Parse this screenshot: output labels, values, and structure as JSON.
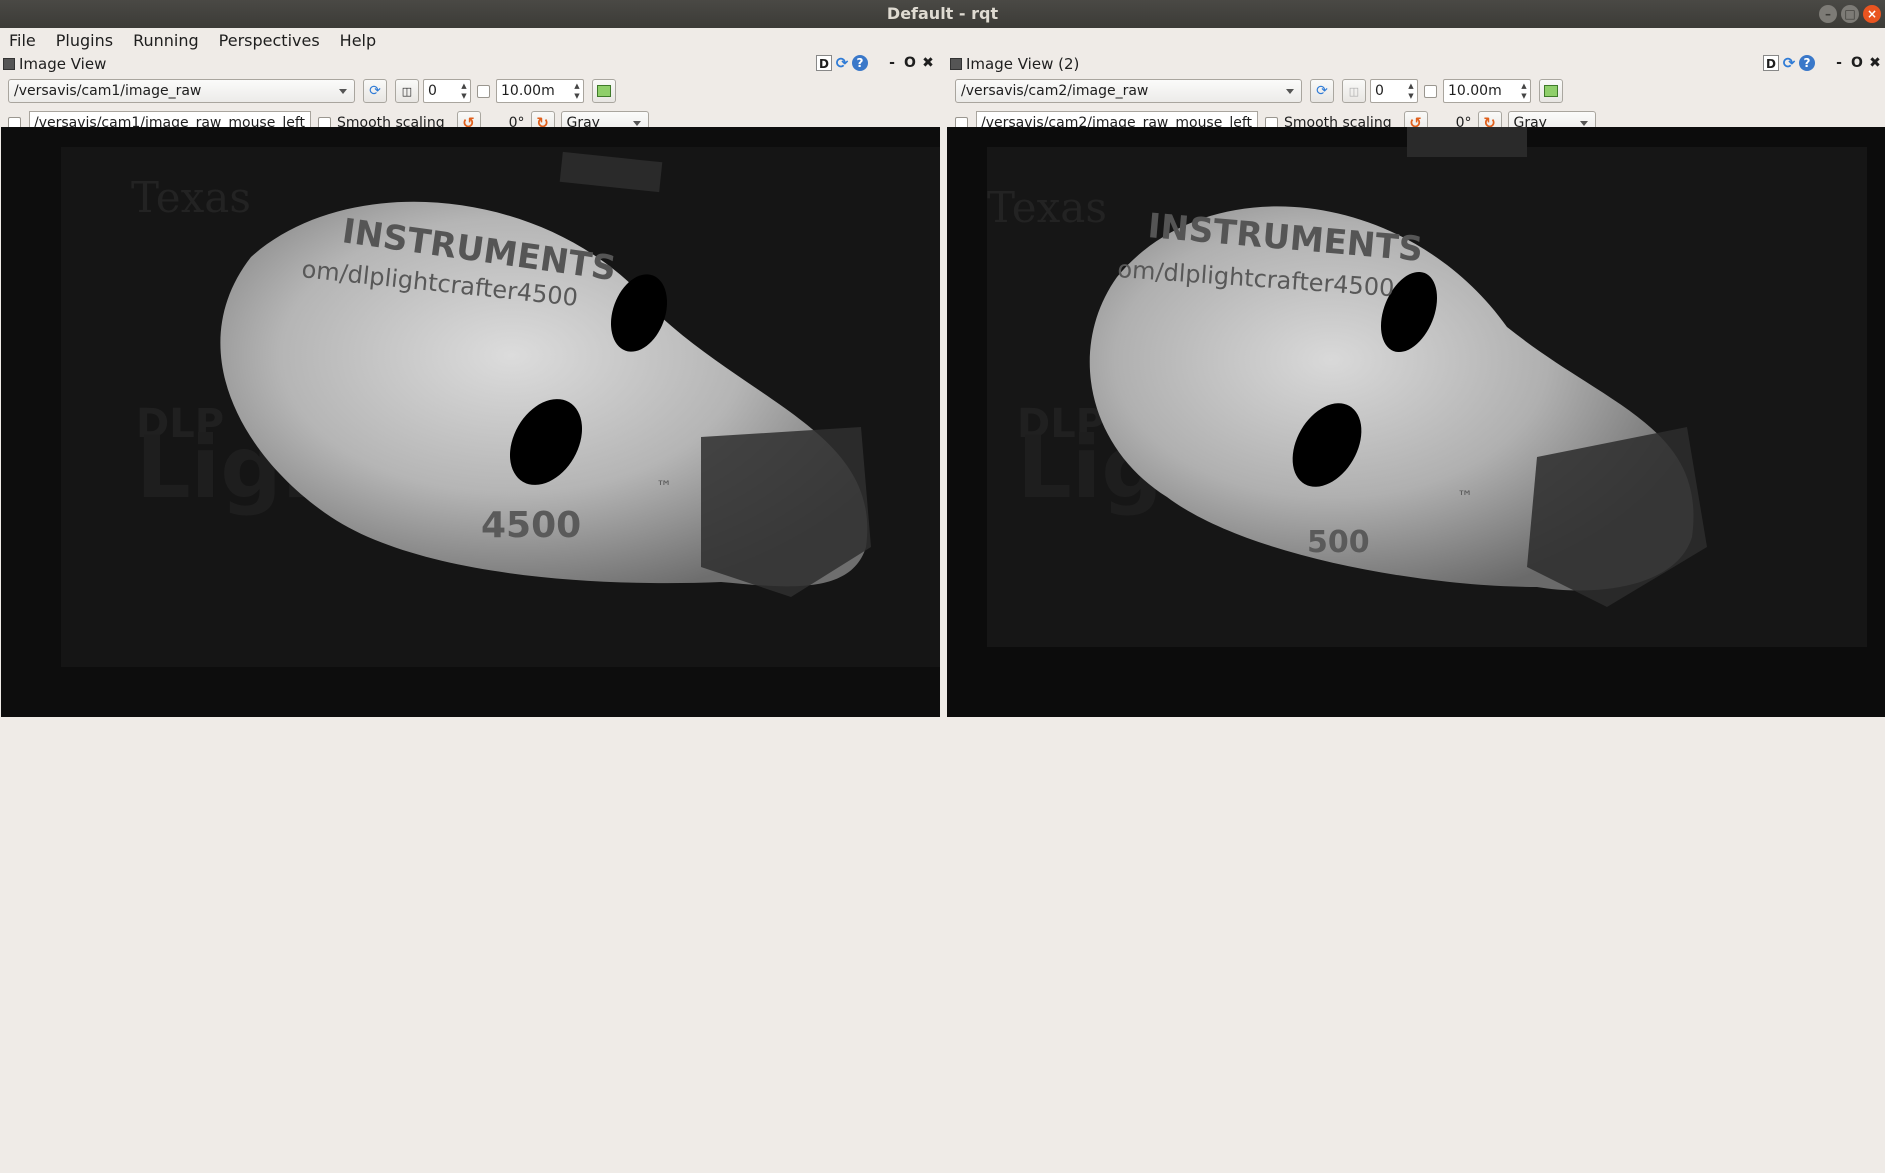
{
  "window": {
    "title": "Default - rqt"
  },
  "menubar": {
    "items": [
      {
        "label": "File"
      },
      {
        "label": "Plugins"
      },
      {
        "label": "Running"
      },
      {
        "label": "Perspectives"
      },
      {
        "label": "Help"
      }
    ]
  },
  "panels": [
    {
      "title": "Image View",
      "topic": "/versavis/cam1/image_raw",
      "frame_value": "0",
      "max_value": "10.00m",
      "mouse_topic": "/versavis/cam1/image_raw_mouse_left",
      "smooth_label": "Smooth scaling",
      "rotation": "0°",
      "colormap": "Gray",
      "image_text": {
        "brand": "INSTRUMENTS",
        "url": "om/dlplightcrafter4500",
        "dlp": "DLP",
        "product": "LightCrafter",
        "tm": "™",
        "number": "4500"
      }
    },
    {
      "title": "Image View (2)",
      "topic": "/versavis/cam2/image_raw",
      "frame_value": "0",
      "max_value": "10.00m",
      "mouse_topic": "/versavis/cam2/image_raw_mouse_left",
      "smooth_label": "Smooth scaling",
      "rotation": "0°",
      "colormap": "Gray",
      "image_text": {
        "brand": "INSTRUMENTS",
        "url": "om/dlplightcrafter4500",
        "dlp": "DLP",
        "product": "LightCrafter",
        "tm": "™",
        "number": "500"
      }
    }
  ],
  "panel_controls": {
    "d": "D",
    "min": "-",
    "o": "O",
    "close": "✖"
  }
}
